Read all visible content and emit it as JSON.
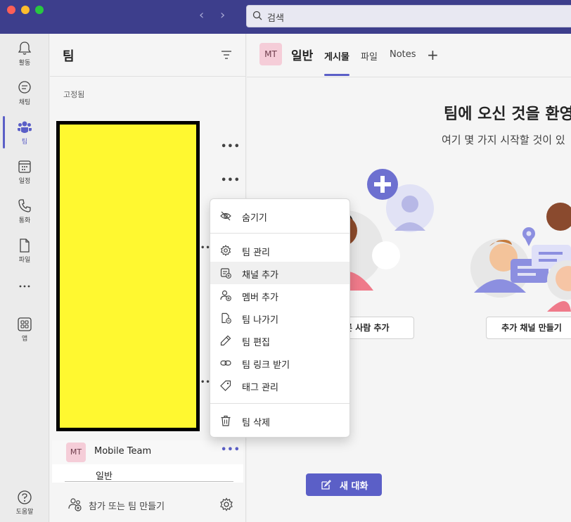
{
  "titlebar": {
    "search_placeholder": "검색",
    "back_icon": "chevron-left-icon",
    "forward_icon": "chevron-right-icon"
  },
  "rail": {
    "items": [
      {
        "label": "활동",
        "icon": "bell-icon"
      },
      {
        "label": "채팅",
        "icon": "chat-icon"
      },
      {
        "label": "팀",
        "icon": "teams-icon"
      },
      {
        "label": "일정",
        "icon": "calendar-icon"
      },
      {
        "label": "통화",
        "icon": "phone-icon"
      },
      {
        "label": "파일",
        "icon": "file-icon"
      },
      {
        "label": "",
        "icon": "more-icon"
      },
      {
        "label": "앱",
        "icon": "apps-icon"
      }
    ],
    "help_label": "도움말",
    "accent": "#5b5fc7"
  },
  "panel": {
    "title": "팀",
    "pinned_label": "고정됨",
    "team": {
      "avatar": "MT",
      "name": "Mobile Team"
    },
    "channel": {
      "name": "일반"
    },
    "join_label": "참가 또는 팀 만들기"
  },
  "main": {
    "channel_avatar": "MT",
    "channel_title": "일반",
    "tabs": [
      "게시물",
      "파일",
      "Notes"
    ],
    "welcome_title": "팀에 오신 것을 환영",
    "welcome_sub": "여기 몇 가지 시작할 것이 있",
    "add_people_label": "른 사람 추가",
    "add_channel_label": "추가 채널 만들기",
    "new_chat_label": "새 대화"
  },
  "menu": {
    "items": [
      {
        "label": "숨기기",
        "icon": "eye-off-icon"
      },
      {
        "label": "팀 관리",
        "icon": "gear-icon"
      },
      {
        "label": "채널 추가",
        "icon": "add-channel-icon"
      },
      {
        "label": "멤버 추가",
        "icon": "add-person-icon"
      },
      {
        "label": "팀 나가기",
        "icon": "leave-icon"
      },
      {
        "label": "팀 편집",
        "icon": "pencil-icon"
      },
      {
        "label": "팀 링크 받기",
        "icon": "link-icon"
      },
      {
        "label": "태그 관리",
        "icon": "tag-icon"
      },
      {
        "label": "팀 삭제",
        "icon": "trash-icon"
      }
    ]
  }
}
